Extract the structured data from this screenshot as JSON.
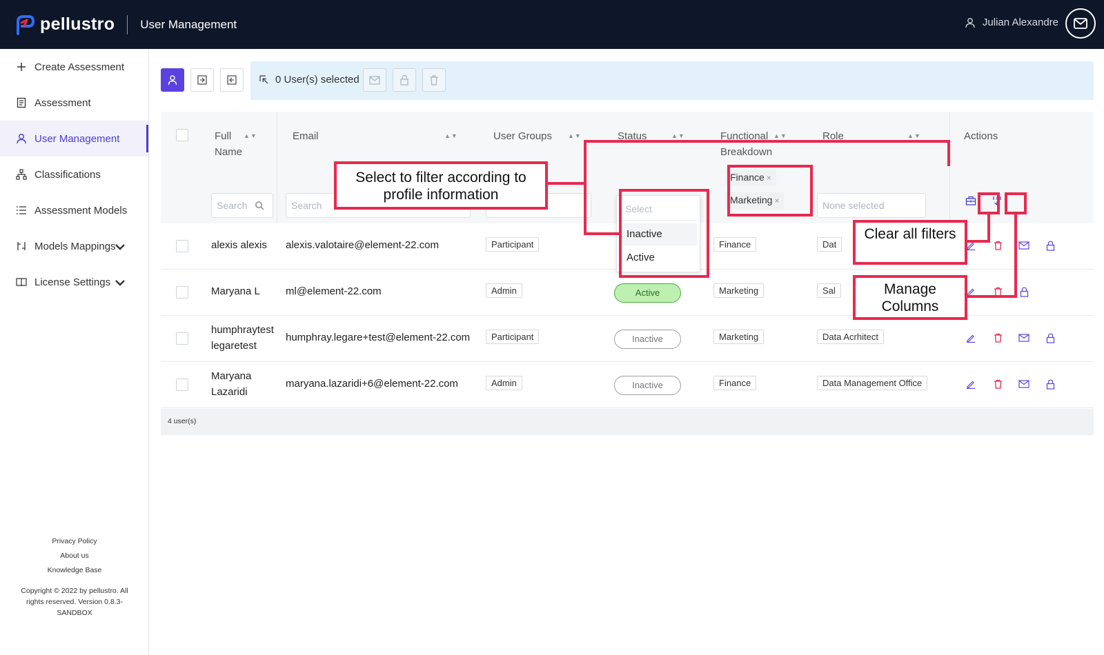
{
  "app": {
    "brand": "pellustro",
    "page_title": "User Management",
    "user_name": "Julian Alexandre"
  },
  "sidebar": {
    "items": [
      {
        "label": "Create Assessment",
        "icon": "plus-icon"
      },
      {
        "label": "Assessment",
        "icon": "document-icon"
      },
      {
        "label": "User Management",
        "icon": "user-icon",
        "active": true
      },
      {
        "label": "Classifications",
        "icon": "hierarchy-icon"
      },
      {
        "label": "Assessment Models",
        "icon": "list-icon"
      },
      {
        "label": "Models Mappings",
        "icon": "mapping-icon",
        "expandable": true
      },
      {
        "label": "License Settings",
        "icon": "book-icon",
        "expandable": true
      }
    ],
    "footer": {
      "privacy": "Privacy Policy",
      "about": "About us",
      "kb": "Knowledge Base",
      "copyright": "Copyright © 2022 by pellustro. All rights reserved. Version 0.8.3-SANDBOX"
    }
  },
  "toolbar": {
    "selected_text": "0 User(s) selected"
  },
  "table": {
    "columns": {
      "full_name": "Full Name",
      "email": "Email",
      "user_groups": "User Groups",
      "status": "Status",
      "functional_breakdown": "Functional Breakdown",
      "role": "Role",
      "actions": "Actions"
    },
    "filters": {
      "name_placeholder": "Search",
      "email_placeholder": "Search",
      "status_placeholder": "Select",
      "functional_chips": [
        "Finance",
        "Marketing"
      ],
      "role_placeholder": "None selected"
    },
    "status_dropdown": {
      "placeholder": "Select",
      "options": [
        "Inactive",
        "Active"
      ]
    },
    "rows": [
      {
        "name": "alexis alexis",
        "email": "alexis.valotaire@element-22.com",
        "group": "Participant",
        "status": "",
        "functional": "Finance",
        "role": "Dat"
      },
      {
        "name": "Maryana L",
        "email": "ml@element-22.com",
        "group": "Admin",
        "status": "Active",
        "functional": "Marketing",
        "role": "Sal"
      },
      {
        "name": "humphraytest legaretest",
        "email": "humphray.legare+test@element-22.com",
        "group": "Participant",
        "status": "Inactive",
        "functional": "Marketing",
        "role": "Data Acrhitect"
      },
      {
        "name": "Maryana Lazaridi",
        "email": "maryana.lazaridi+6@element-22.com",
        "group": "Admin",
        "status": "Inactive",
        "functional": "Finance",
        "role": "Data Management Office"
      }
    ],
    "footer_count": "4 user(s)"
  },
  "annotations": {
    "filter_callout": "Select to filter according to profile information",
    "clear_callout": "Clear all filters",
    "manage_callout": "Manage Columns"
  },
  "colors": {
    "topbar": "#0e1629",
    "accent": "#5a41e0",
    "callout": "#e8294f",
    "selection_bar": "#e3f1fb",
    "active_pill": "#bdf0b1"
  }
}
